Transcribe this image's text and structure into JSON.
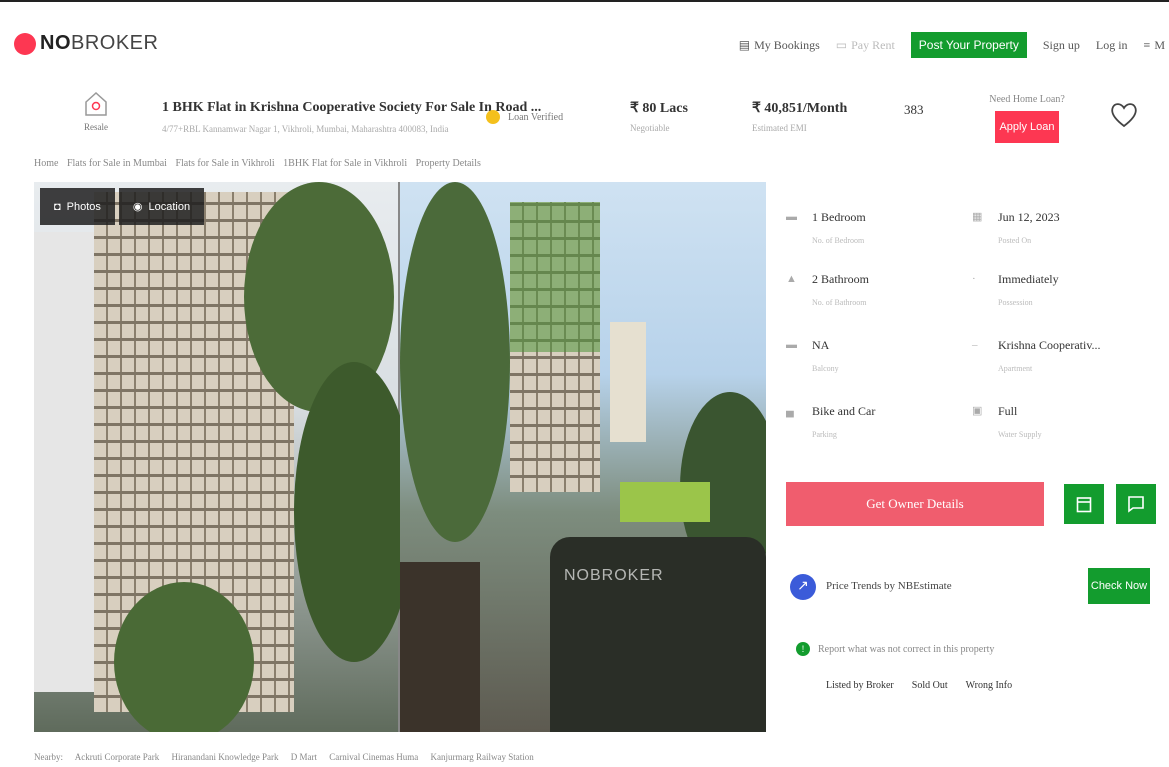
{
  "header": {
    "logo_no": "NO",
    "logo_broker": "BROKER",
    "nav": {
      "bookings": "My Bookings",
      "pay_rent": "Pay Rent",
      "post_property": "Post Your Property",
      "sign_up": "Sign up",
      "log_in": "Log in",
      "menu": "M"
    }
  },
  "property": {
    "type_label": "Resale",
    "title": "1 BHK Flat in Krishna Cooperative Society For Sale In Road ...",
    "address": "4/77+RBL Kannamwar Nagar 1, Vikhroli, Mumbai, Maharashtra 400083, India",
    "loan_verified": "Loan Verified",
    "price": "₹ 80 Lacs",
    "price_sub": "Negotiable",
    "emi": "₹ 40,851/Month",
    "emi_sub": "Estimated EMI",
    "views": "383",
    "need_loan": "Need Home Loan?",
    "apply_loan": "Apply Loan"
  },
  "breadcrumb": [
    "Home",
    "Flats for Sale in Mumbai",
    "Flats for Sale in Vikhroli",
    "1BHK Flat for Sale in Vikhroli",
    "Property Details"
  ],
  "gallery": {
    "photos_tab": "Photos",
    "location_tab": "Location",
    "watermark": "NOBROKER"
  },
  "specs": [
    {
      "icon": "bed-icon",
      "value": "1 Bedroom",
      "label": "No. of Bedroom"
    },
    {
      "icon": "calendar-icon",
      "value": "Jun 12, 2023",
      "label": "Posted On"
    },
    {
      "icon": "bath-icon",
      "value": "2 Bathroom",
      "label": "No. of Bathroom"
    },
    {
      "icon": "key-icon",
      "value": "Immediately",
      "label": "Possession"
    },
    {
      "icon": "balcony-icon",
      "value": "NA",
      "label": "Balcony"
    },
    {
      "icon": "building-icon",
      "value": "Krishna Cooperativ...",
      "label": "Apartment"
    },
    {
      "icon": "car-icon",
      "value": "Bike and Car",
      "label": "Parking"
    },
    {
      "icon": "document-icon",
      "value": "Full",
      "label": "Water Supply"
    }
  ],
  "actions": {
    "owner_details": "Get Owner Details",
    "price_trends": "Price Trends by NBEstimate",
    "check_now": "Check Now",
    "report_text": "Report what was not correct in this property",
    "report_options": [
      "Listed by Broker",
      "Sold Out",
      "Wrong Info"
    ]
  },
  "nearby": {
    "label": "Nearby:",
    "places": [
      "Ackruti Corporate Park",
      "Hiranandani Knowledge Park",
      "D Mart",
      "Carnival Cinemas Huma",
      "Kanjurmarg Railway Station"
    ]
  },
  "colors": {
    "brand_red": "#fd3752",
    "brand_green": "#139c2e",
    "cta_pink": "#f05d6e"
  }
}
